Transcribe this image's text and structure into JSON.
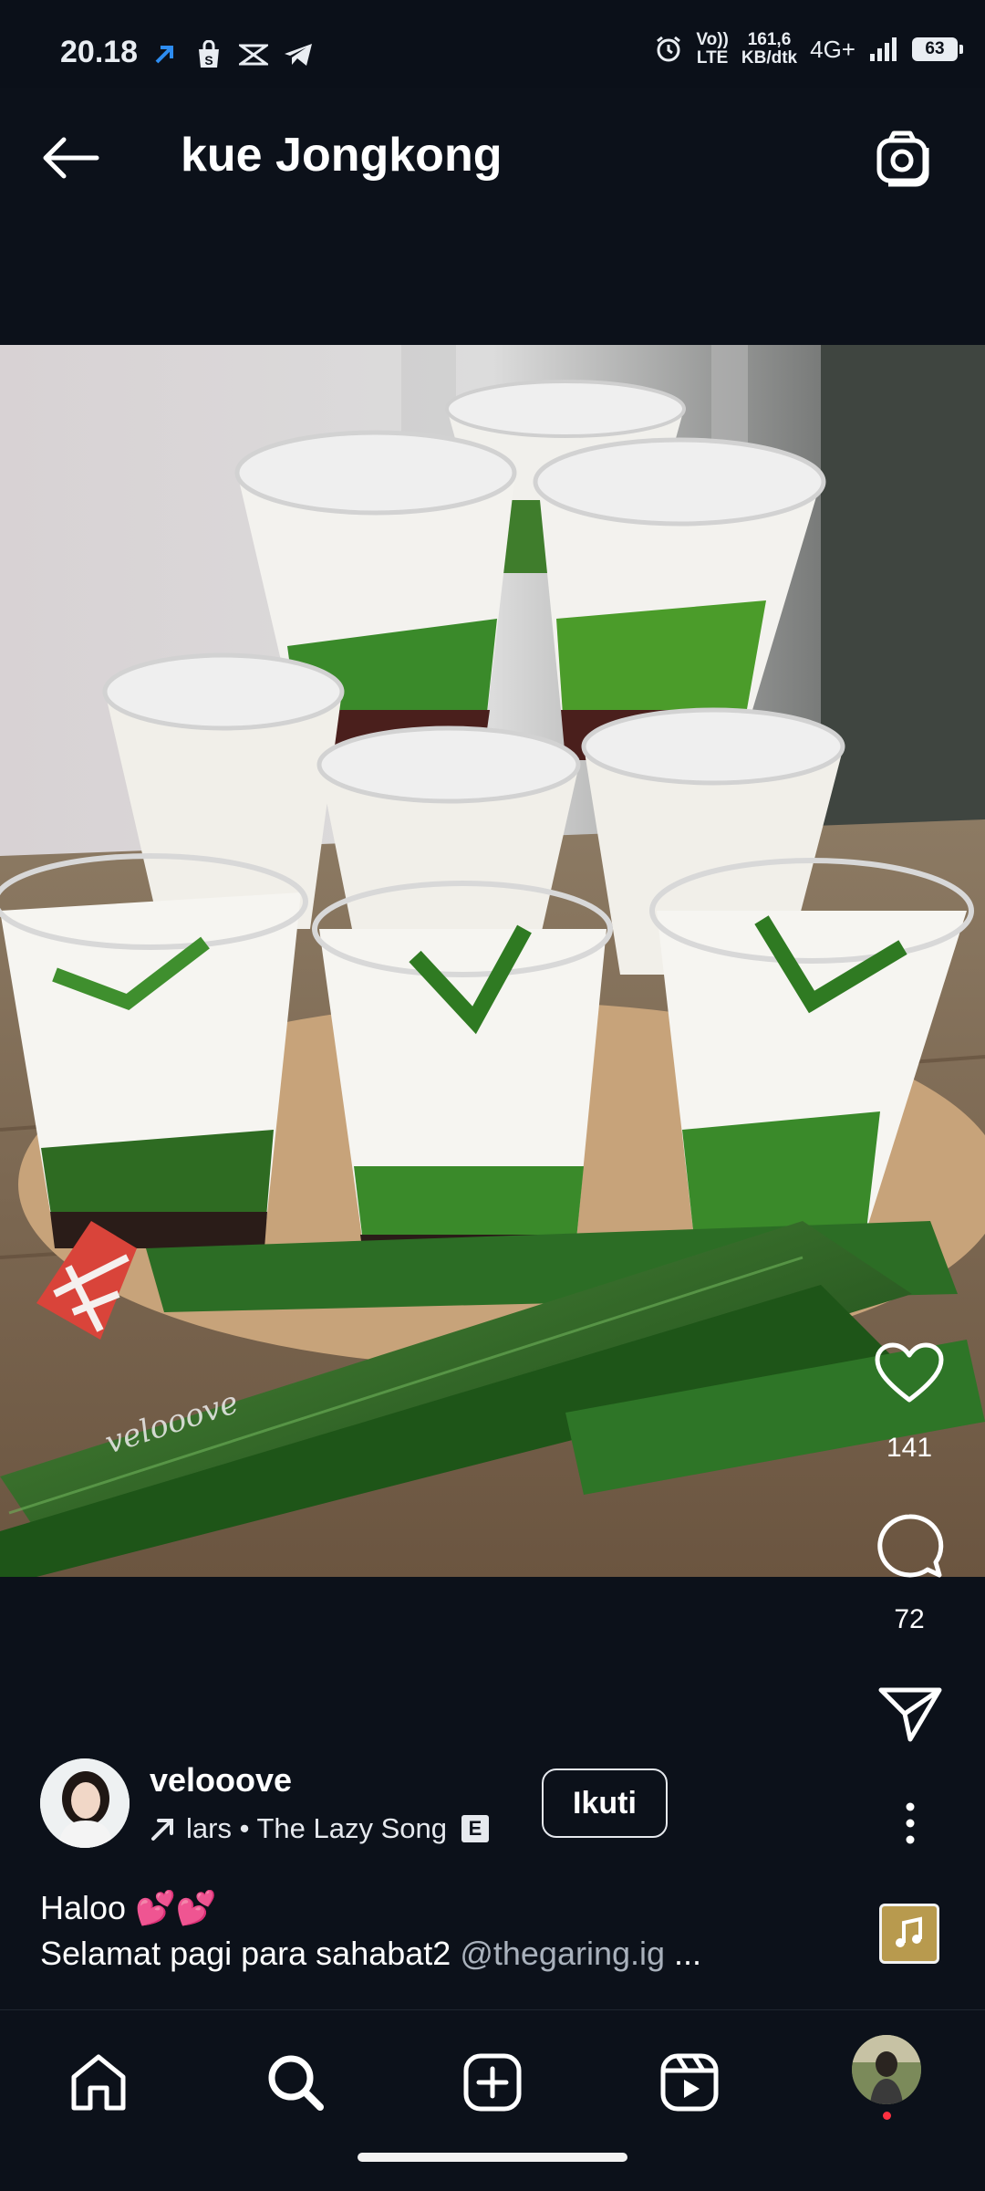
{
  "status_bar": {
    "time": "20.18",
    "network_speed_value": "161,6",
    "network_speed_unit": "KB/dtk",
    "lte_top": "Vo))",
    "lte_bottom": "LTE",
    "network_type": "4G+",
    "battery": "63"
  },
  "header": {
    "title": "kue Jongkong"
  },
  "media": {
    "watermark": "velooove"
  },
  "actions": {
    "likes": "141",
    "comments": "72"
  },
  "post": {
    "username": "velooove",
    "music_text": "lars • The Lazy Song",
    "explicit_badge": "E",
    "follow_label": "Ikuti",
    "caption_line1": "Haloo 💕💕",
    "caption_line2_text": "Selamat pagi para sahabat2 ",
    "caption_line2_mention": "@thegaring.ig",
    "caption_more": " ..."
  },
  "colors": {
    "background": "#0c111a",
    "text": "#ffffff",
    "muted_text": "#a9b1bc",
    "notification_dot": "#ff3040"
  }
}
